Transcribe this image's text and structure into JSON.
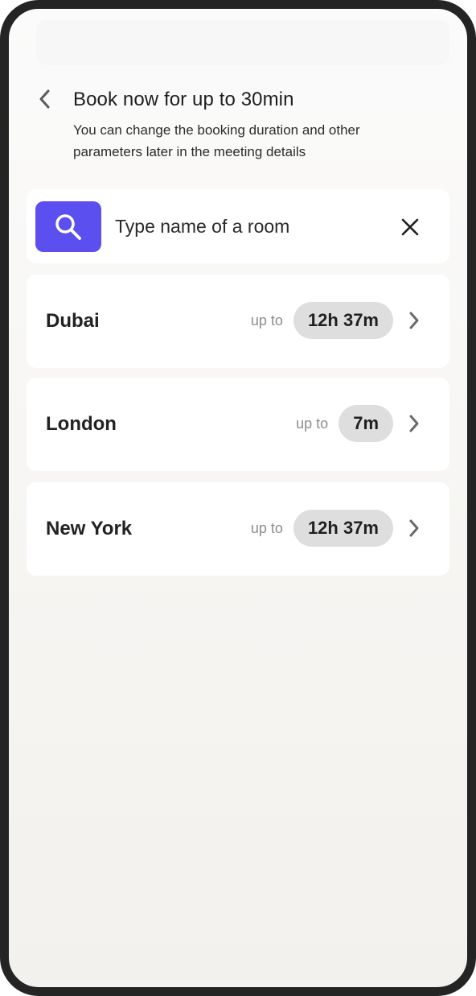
{
  "header": {
    "title": "Book now for up to 30min",
    "subtitle": "You can change the booking duration and other parameters later in the meeting details",
    "back_icon": "chevron-left-icon"
  },
  "search": {
    "placeholder": "Type name of a room",
    "value": "",
    "search_icon": "search-icon",
    "clear_icon": "close-icon",
    "accent_color": "#5b4ff0"
  },
  "rooms": [
    {
      "name": "Dubai",
      "up_to_label": "up to",
      "duration": "12h 37m"
    },
    {
      "name": "London",
      "up_to_label": "up to",
      "duration": "7m"
    },
    {
      "name": "New York",
      "up_to_label": "up to",
      "duration": "12h 37m"
    }
  ]
}
